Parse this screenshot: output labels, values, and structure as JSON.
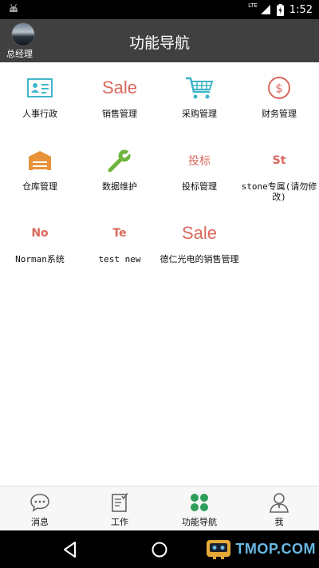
{
  "status_bar": {
    "network": "LTE",
    "time": "1:52"
  },
  "header": {
    "user_role": "总经理",
    "title": "功能导航"
  },
  "modules": [
    {
      "label": "人事行政",
      "icon": "id-card-icon",
      "color": "#3fb6c9"
    },
    {
      "label": "销售管理",
      "icon_text": "Sale",
      "color": "#d9695d"
    },
    {
      "label": "采购管理",
      "icon": "shopping-cart-icon",
      "color": "#3fb6c9"
    },
    {
      "label": "财务管理",
      "icon": "dollar-circle-icon",
      "color": "#d9695d"
    },
    {
      "label": "仓库管理",
      "icon": "warehouse-icon",
      "color": "#e8923a"
    },
    {
      "label": "数据维护",
      "icon": "wrench-icon",
      "color": "#6fb43f"
    },
    {
      "label": "投标管理",
      "icon_text": "投标",
      "color": "#d9695d"
    },
    {
      "label": "stone专属(请勿修改)",
      "icon_text": "St",
      "color": "#d9695d"
    },
    {
      "label": "Norman系统",
      "icon_text": "No",
      "color": "#d9695d"
    },
    {
      "label": "test new",
      "icon_text": "Te",
      "color": "#d9695d"
    },
    {
      "label": "德仁光电的销售管理",
      "icon_text": "Sale",
      "color": "#d9695d"
    }
  ],
  "bottom_nav": [
    {
      "label": "消息",
      "icon": "chat-bubble-icon"
    },
    {
      "label": "工作",
      "icon": "clipboard-icon"
    },
    {
      "label": "功能导航",
      "icon": "four-dots-icon",
      "active": true,
      "color": "#2e9e5b"
    },
    {
      "label": "我",
      "icon": "person-icon"
    }
  ],
  "watermark": "TMOP.COM"
}
